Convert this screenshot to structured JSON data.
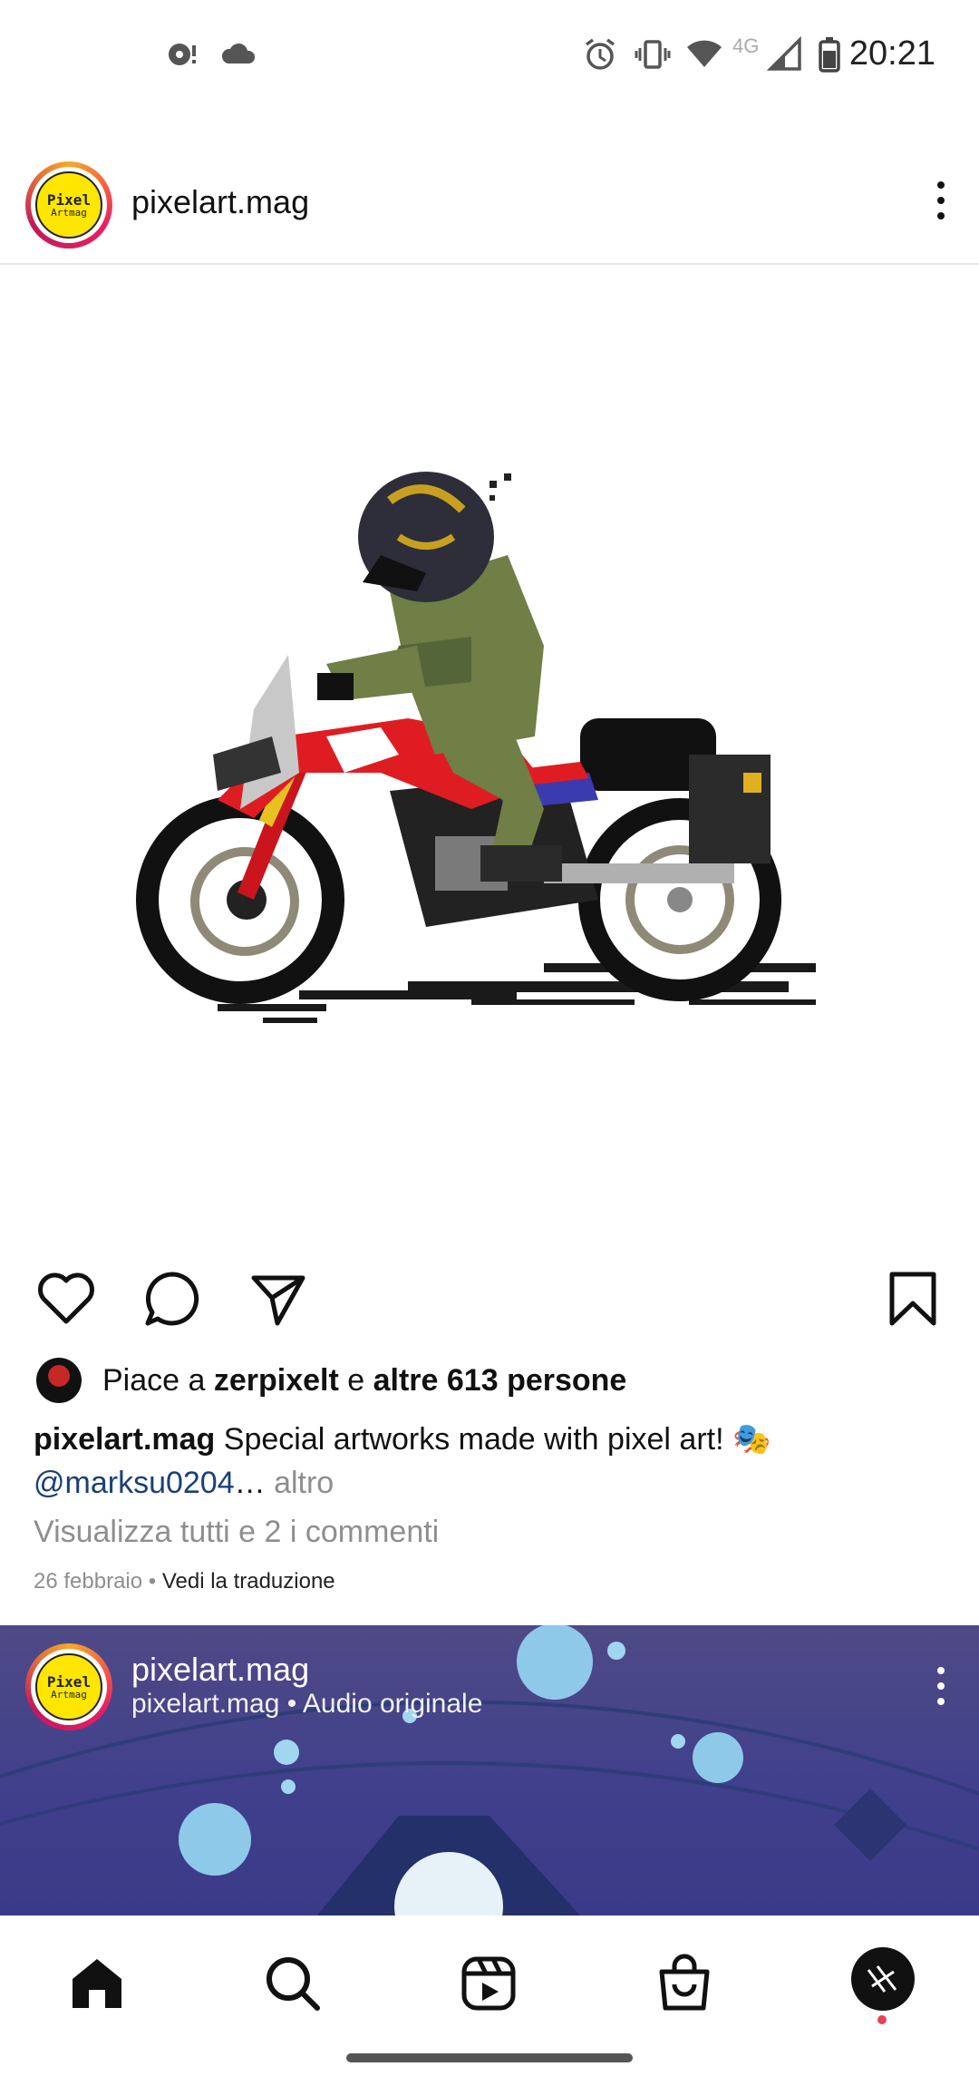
{
  "status_bar": {
    "time": "20:21",
    "network_label": "4G",
    "left_icons": [
      "media-icon",
      "cloud-icon"
    ],
    "right_icons": [
      "alarm-icon",
      "vibrate-icon",
      "wifi-icon",
      "signal-icon",
      "battery-icon"
    ]
  },
  "post": {
    "username": "pixelart.mag",
    "avatar_text_line1": "Pixel",
    "avatar_text_line2": "Artmag",
    "likes": {
      "prefix": "Piace a ",
      "user": "zerpixelt",
      "middle": " e ",
      "others": "altre 613 persone"
    },
    "caption": {
      "username": "pixelart.mag",
      "text": "Special artworks made with pixel art! 🎭",
      "mention": "@marksu0204",
      "ellipsis": "…",
      "more": "altro"
    },
    "view_comments": "Visualizza tutti e 2 i commenti",
    "date": "26 febbraio",
    "separator": " • ",
    "translate": "Vedi la traduzione"
  },
  "next_post": {
    "username": "pixelart.mag",
    "subtitle": "pixelart.mag • Audio originale",
    "avatar_text_line1": "Pixel",
    "avatar_text_line2": "Artmag"
  },
  "colors": {
    "mention": "#1b3f7a",
    "secondary_text": "#8e8e8e",
    "notification_dot": "#e6415a",
    "next_post_bg": "#4f4a86"
  },
  "bottom_nav": [
    "home-icon",
    "search-icon",
    "reels-icon",
    "shop-icon",
    "profile-avatar"
  ]
}
